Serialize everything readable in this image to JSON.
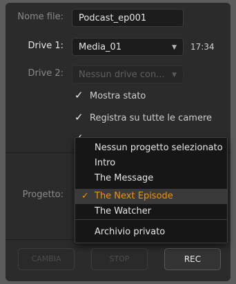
{
  "form": {
    "filename_label": "Nome file:",
    "filename_value": "Podcast_ep001",
    "drive1_label": "Drive 1:",
    "drive1_value": "Media_01",
    "drive1_time": "17:34",
    "drive2_label": "Drive 2:",
    "drive2_value": "Nessun drive con...",
    "checkboxes": [
      {
        "label": "Mostra stato",
        "checked": true
      },
      {
        "label": "Registra su tutte le camere",
        "checked": true
      }
    ],
    "project_label": "Progetto:"
  },
  "project_menu": {
    "items": [
      {
        "label": "Nessun progetto selezionato",
        "selected": false
      },
      {
        "label": "Intro",
        "selected": false
      },
      {
        "label": "The Message",
        "selected": false
      },
      {
        "label": "The Next Episode",
        "selected": true
      },
      {
        "label": "The Watcher",
        "selected": false
      },
      {
        "label": "Archivio privato",
        "selected": false
      }
    ],
    "check_glyph": "✓",
    "selected_color": "#f29300"
  },
  "buttons": {
    "change_label": "CAMBIA",
    "stop_label": "STOP",
    "rec_label": "REC"
  },
  "icons": {
    "dropdown": "▼",
    "check": "✓"
  }
}
